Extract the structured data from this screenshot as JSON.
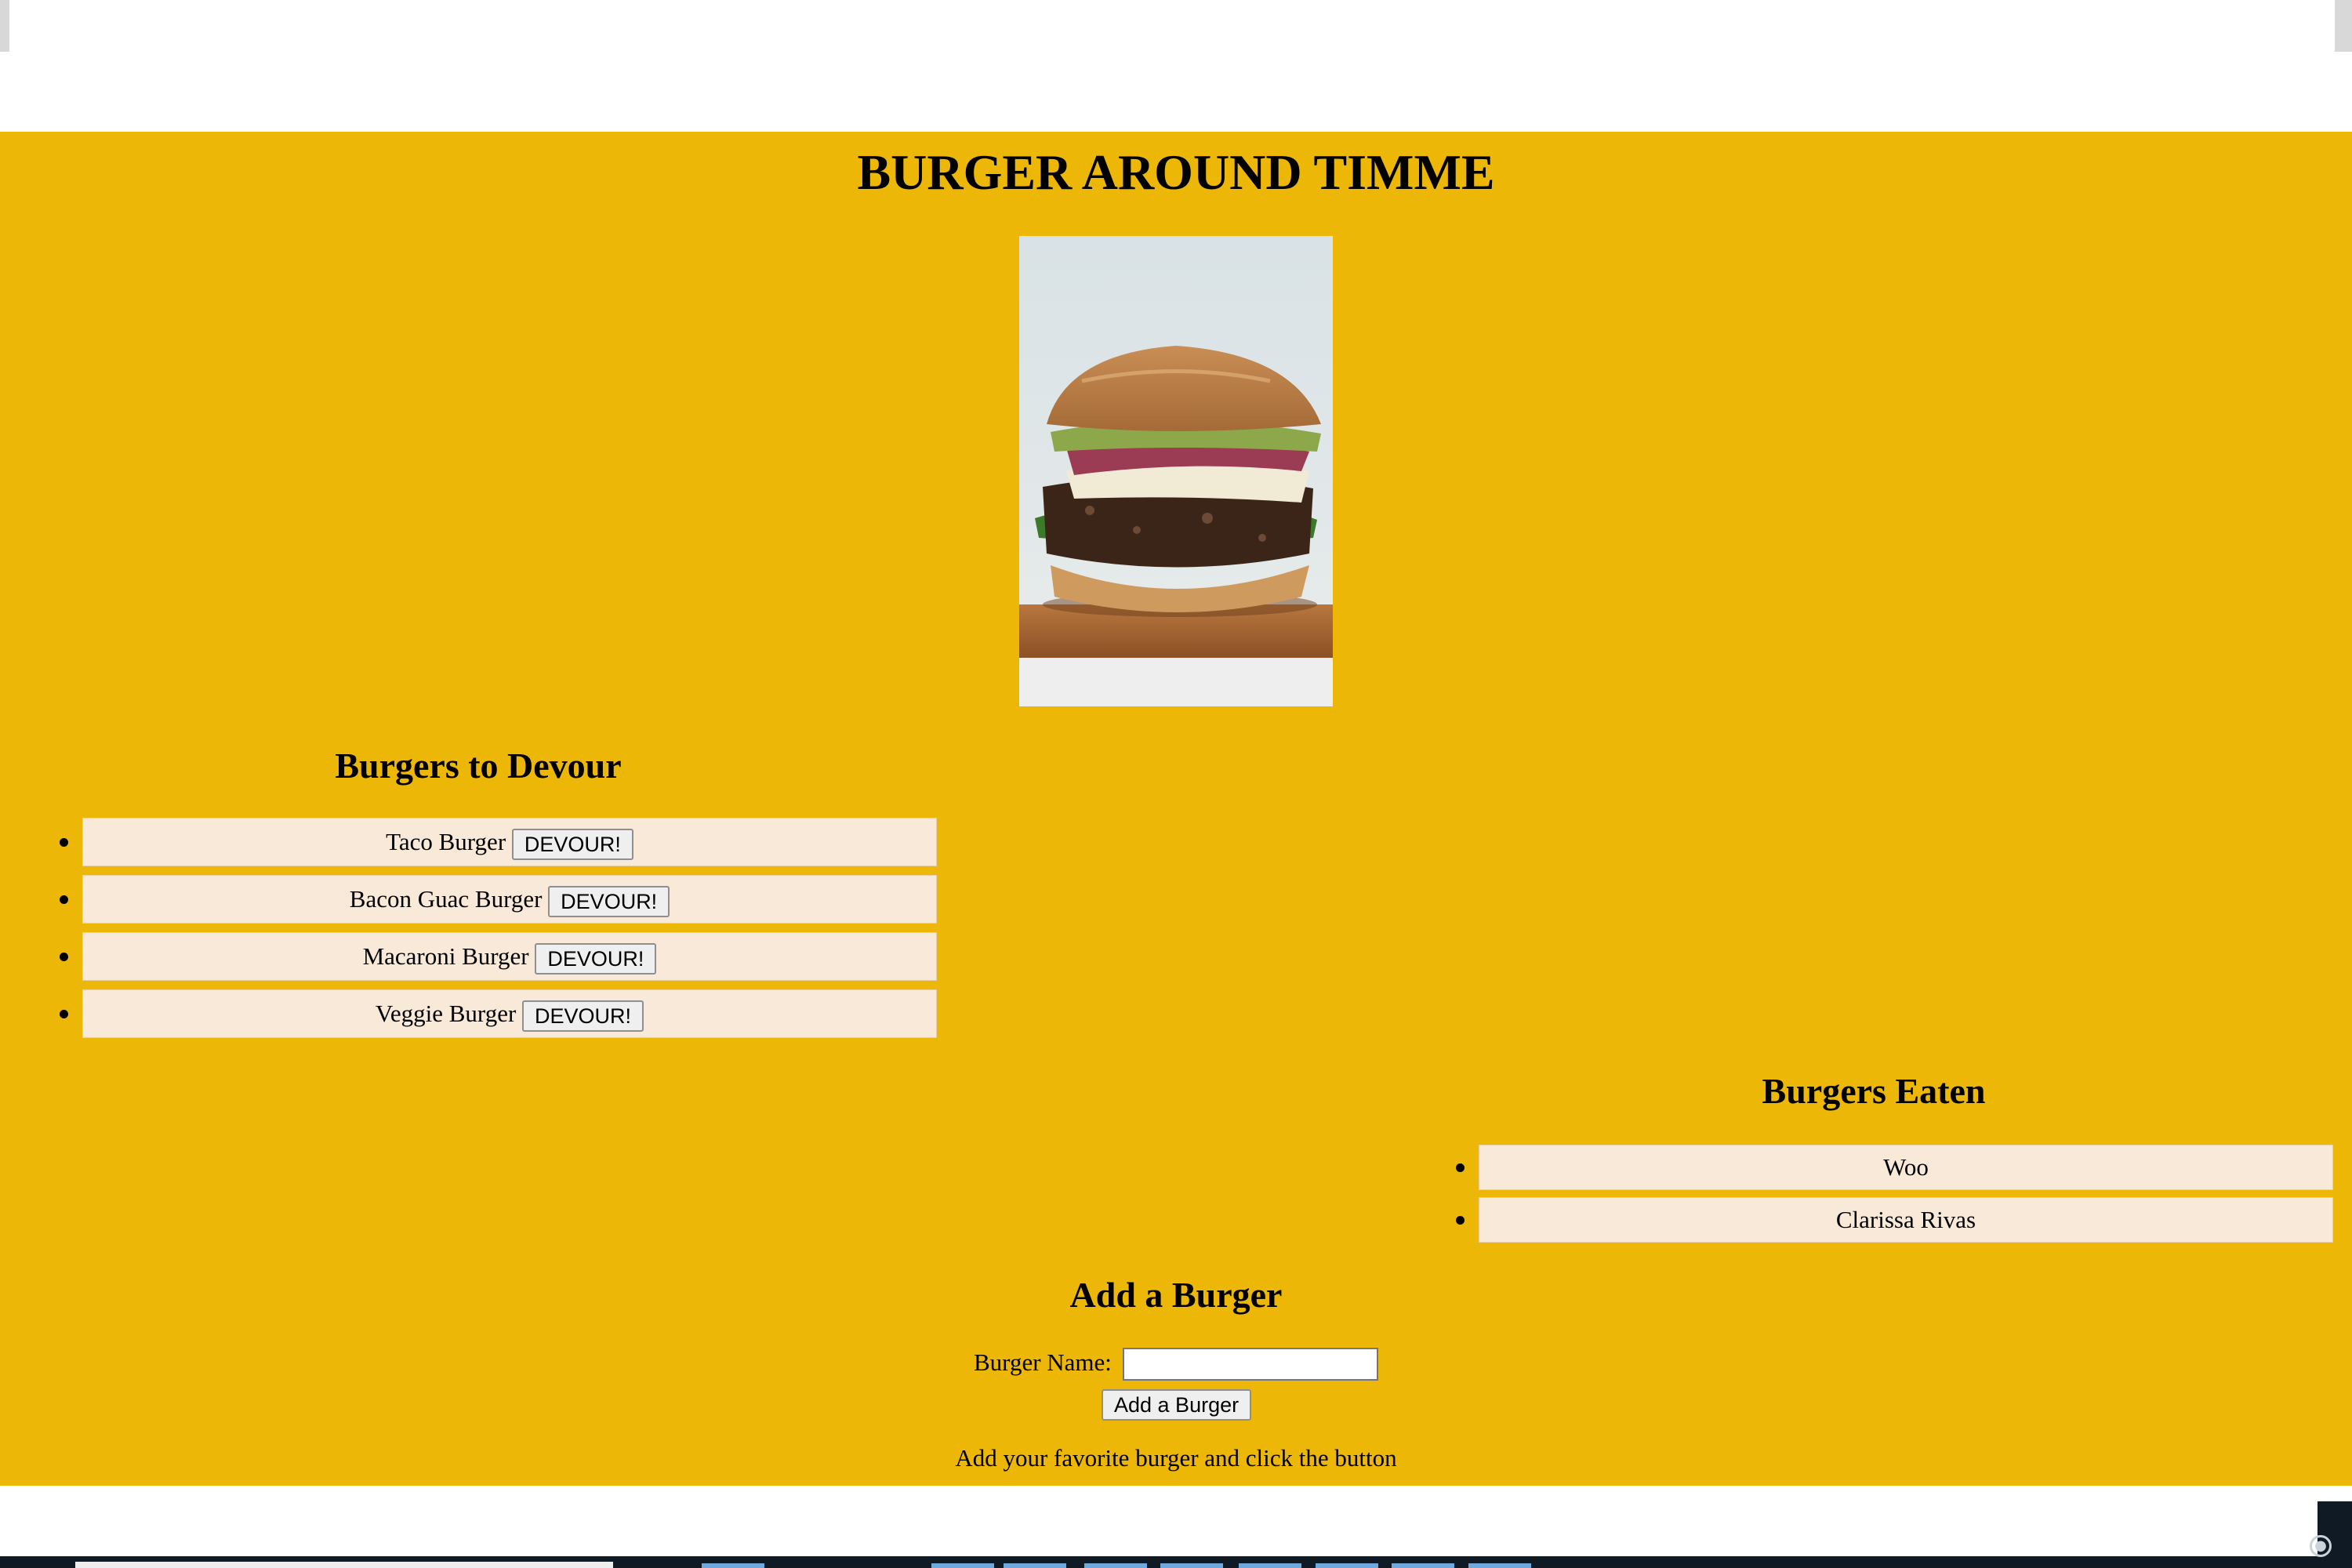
{
  "header": {
    "title": "BURGER AROUND TIMME"
  },
  "hero": {
    "image_alt": "burger-photo"
  },
  "devour": {
    "title": "Burgers to Devour",
    "button_label": "DEVOUR!",
    "items": [
      {
        "name": "Taco Burger"
      },
      {
        "name": "Bacon Guac Burger"
      },
      {
        "name": "Macaroni Burger"
      },
      {
        "name": "Veggie Burger"
      }
    ]
  },
  "eaten": {
    "title": "Burgers Eaten",
    "items": [
      {
        "name": "Woo"
      },
      {
        "name": "Clarissa Rivas"
      }
    ]
  },
  "add_form": {
    "title": "Add a Burger",
    "label": "Burger Name:",
    "input_value": "",
    "submit_label": "Add a Burger",
    "hint": "Add your favorite burger and click the button"
  },
  "colors": {
    "page_background": "#edb707",
    "list_item_background": "#f8e9d8"
  }
}
